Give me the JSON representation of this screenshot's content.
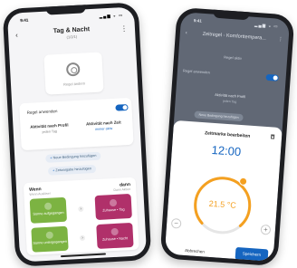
{
  "phone_left": {
    "status": {
      "time": "9:41",
      "sys": "▂▄▆ ◒ ▭"
    },
    "header": {
      "back": "‹",
      "title": "Tag & Nacht",
      "subtitle": "(1/2/1)",
      "menu": "⋮"
    },
    "icon_caption": "Regel ändern",
    "rule_toggle_label": "Regel anwenden",
    "rule_enabled": true,
    "col_left": {
      "title": "Aktivität nach Profil",
      "value": "jeden Tag"
    },
    "col_right": {
      "title": "Aktivität nach Zeit",
      "value": "immer aktiv"
    },
    "chip1": "Neue Bedingung hinzufügen",
    "chip2": "Zeitvorgabe hinzufügen",
    "scene": {
      "wenn": "Wenn",
      "wenn_sub": "Wenn Auslöser",
      "dann": "dann",
      "dann_sub": "Dann Aktion",
      "tiles": [
        {
          "label": "Sonne aufgegangen",
          "color": "#7cb342"
        },
        {
          "label": "Zuhause • Tag",
          "color": "#b0306a"
        },
        {
          "label": "Sonne untergegangen",
          "color": "#7cb342"
        },
        {
          "label": "Zuhause • Nacht",
          "color": "#b0306a"
        }
      ]
    }
  },
  "phone_right": {
    "status": {
      "time": "9:41",
      "sys": "▂▄▆ ◒ ▭"
    },
    "title": "Zeitregel - Komforttempera...",
    "back": "‹",
    "menu": "⋮",
    "regel_label": "Regel aktiv",
    "rule_toggle_label": "Regel anwenden",
    "aktiv_title": "Aktivität nach Profil",
    "aktiv_value": "jeden Tag",
    "chip": "Neue Bedingung hinzufügen",
    "sheet": {
      "title": "Zeitmarke bearbeiten",
      "time": "12:00",
      "temperature": "21.5 °C",
      "minus": "−",
      "plus": "+",
      "cancel_label": "Abbrechen",
      "save_label": "Speichern"
    },
    "colors": {
      "accent": "#1565c0",
      "dial": "#f4a020"
    }
  }
}
